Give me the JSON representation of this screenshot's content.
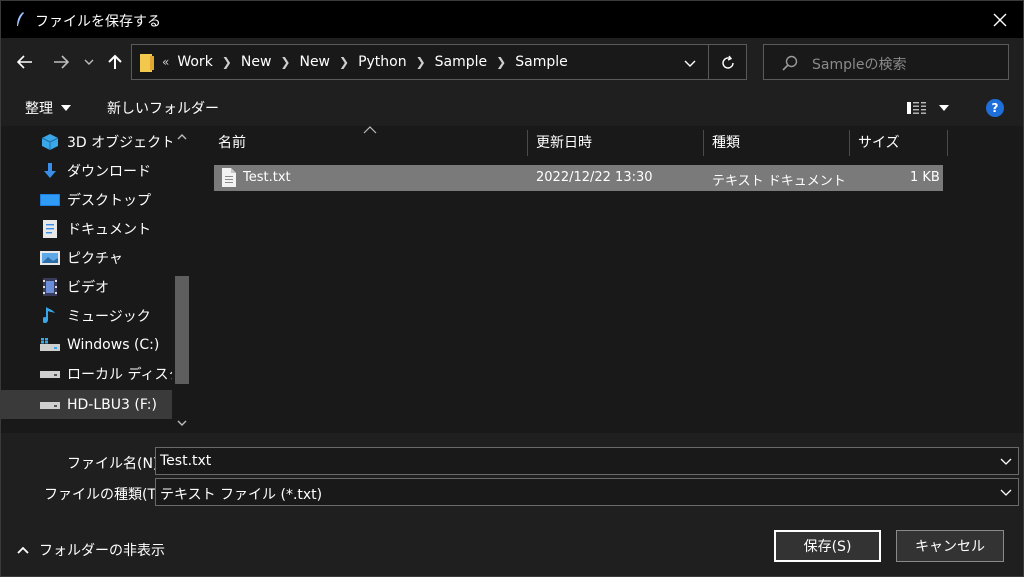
{
  "window": {
    "title": "ファイルを保存する"
  },
  "nav": {
    "overflow": "«",
    "breadcrumbs": [
      "Work",
      "New",
      "New",
      "Python",
      "Sample",
      "Sample"
    ],
    "search_placeholder": "Sampleの検索"
  },
  "toolbar": {
    "organize_label": "整理",
    "new_folder_label": "新しいフォルダー",
    "help_label": "?"
  },
  "sidebar": {
    "items": [
      {
        "label": "3D オブジェクト",
        "icon": "3d-objects-icon"
      },
      {
        "label": "ダウンロード",
        "icon": "download-icon"
      },
      {
        "label": "デスクトップ",
        "icon": "desktop-icon"
      },
      {
        "label": "ドキュメント",
        "icon": "documents-icon"
      },
      {
        "label": "ピクチャ",
        "icon": "pictures-icon"
      },
      {
        "label": "ビデオ",
        "icon": "videos-icon"
      },
      {
        "label": "ミュージック",
        "icon": "music-icon"
      },
      {
        "label": "Windows (C:)",
        "icon": "windows-drive-icon"
      },
      {
        "label": "ローカル ディスク (D",
        "icon": "drive-icon"
      },
      {
        "label": "HD-LBU3 (F:)",
        "icon": "drive-icon"
      }
    ],
    "selected_index": 9
  },
  "columns": {
    "name": "名前",
    "modified": "更新日時",
    "type": "種類",
    "size": "サイズ"
  },
  "files": [
    {
      "name": "Test.txt",
      "modified": "2022/12/22 13:30",
      "type": "テキスト ドキュメント",
      "size": "1 KB"
    }
  ],
  "form": {
    "filename_label": "ファイル名(N):",
    "filename_value": "Test.txt",
    "filetype_label": "ファイルの種類(T):",
    "filetype_value": "テキスト ファイル (*.txt)"
  },
  "footer": {
    "hide_folders_label": "フォルダーの非表示",
    "save_label": "保存(S)",
    "cancel_label": "キャンセル"
  },
  "colors": {
    "accent": "#1e6fd9",
    "folder": "#f2c94c",
    "selected_row": "#7a7a7a"
  }
}
